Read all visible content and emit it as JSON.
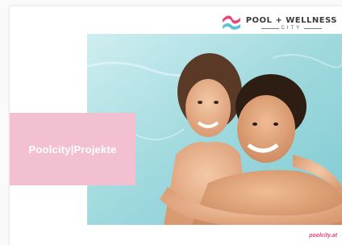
{
  "brand": {
    "title": "POOL + WELLNESS",
    "subtitle": "CITY",
    "colors": {
      "pink": "#e8457d",
      "blue": "#5bc2d6"
    }
  },
  "label": {
    "text": "Poolcity|Projekte",
    "background": "#f3c0d1"
  },
  "photo": {
    "icon": "couple-in-pool-photo"
  },
  "footer": {
    "url": "poolcity.at"
  }
}
